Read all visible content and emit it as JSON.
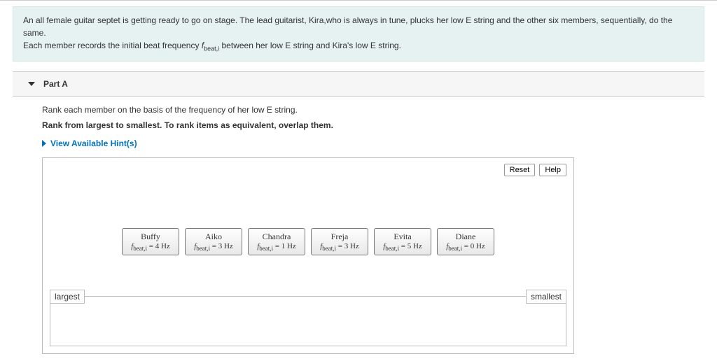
{
  "intro": {
    "line1": "An all female guitar septet is getting ready to go on stage. The lead guitarist, Kira,who is always in tune, plucks her low E string and the other six members, sequentially, do the same.",
    "line2_before": "Each member records the initial beat frequency ",
    "line2_var": "f",
    "line2_sub": "beat,i",
    "line2_after": " between her low E string and Kira's low E string."
  },
  "part": {
    "label": "Part A"
  },
  "instructions": {
    "line1": "Rank each member on the basis of the frequency of her low E string.",
    "line2": "Rank from largest to smallest. To rank items as equivalent, overlap them."
  },
  "hints_label": "View Available Hint(s)",
  "buttons": {
    "reset": "Reset",
    "help": "Help"
  },
  "items": [
    {
      "name": "Buffy",
      "value": "4 Hz"
    },
    {
      "name": "Aiko",
      "value": "3 Hz"
    },
    {
      "name": "Chandra",
      "value": "1 Hz"
    },
    {
      "name": "Freja",
      "value": "3 Hz"
    },
    {
      "name": "Evita",
      "value": "5 Hz"
    },
    {
      "name": "Diane",
      "value": "0 Hz"
    }
  ],
  "var": {
    "f": "f",
    "sub": "beat,i",
    "eq": " = "
  },
  "rank": {
    "left": "largest",
    "right": "smallest"
  }
}
